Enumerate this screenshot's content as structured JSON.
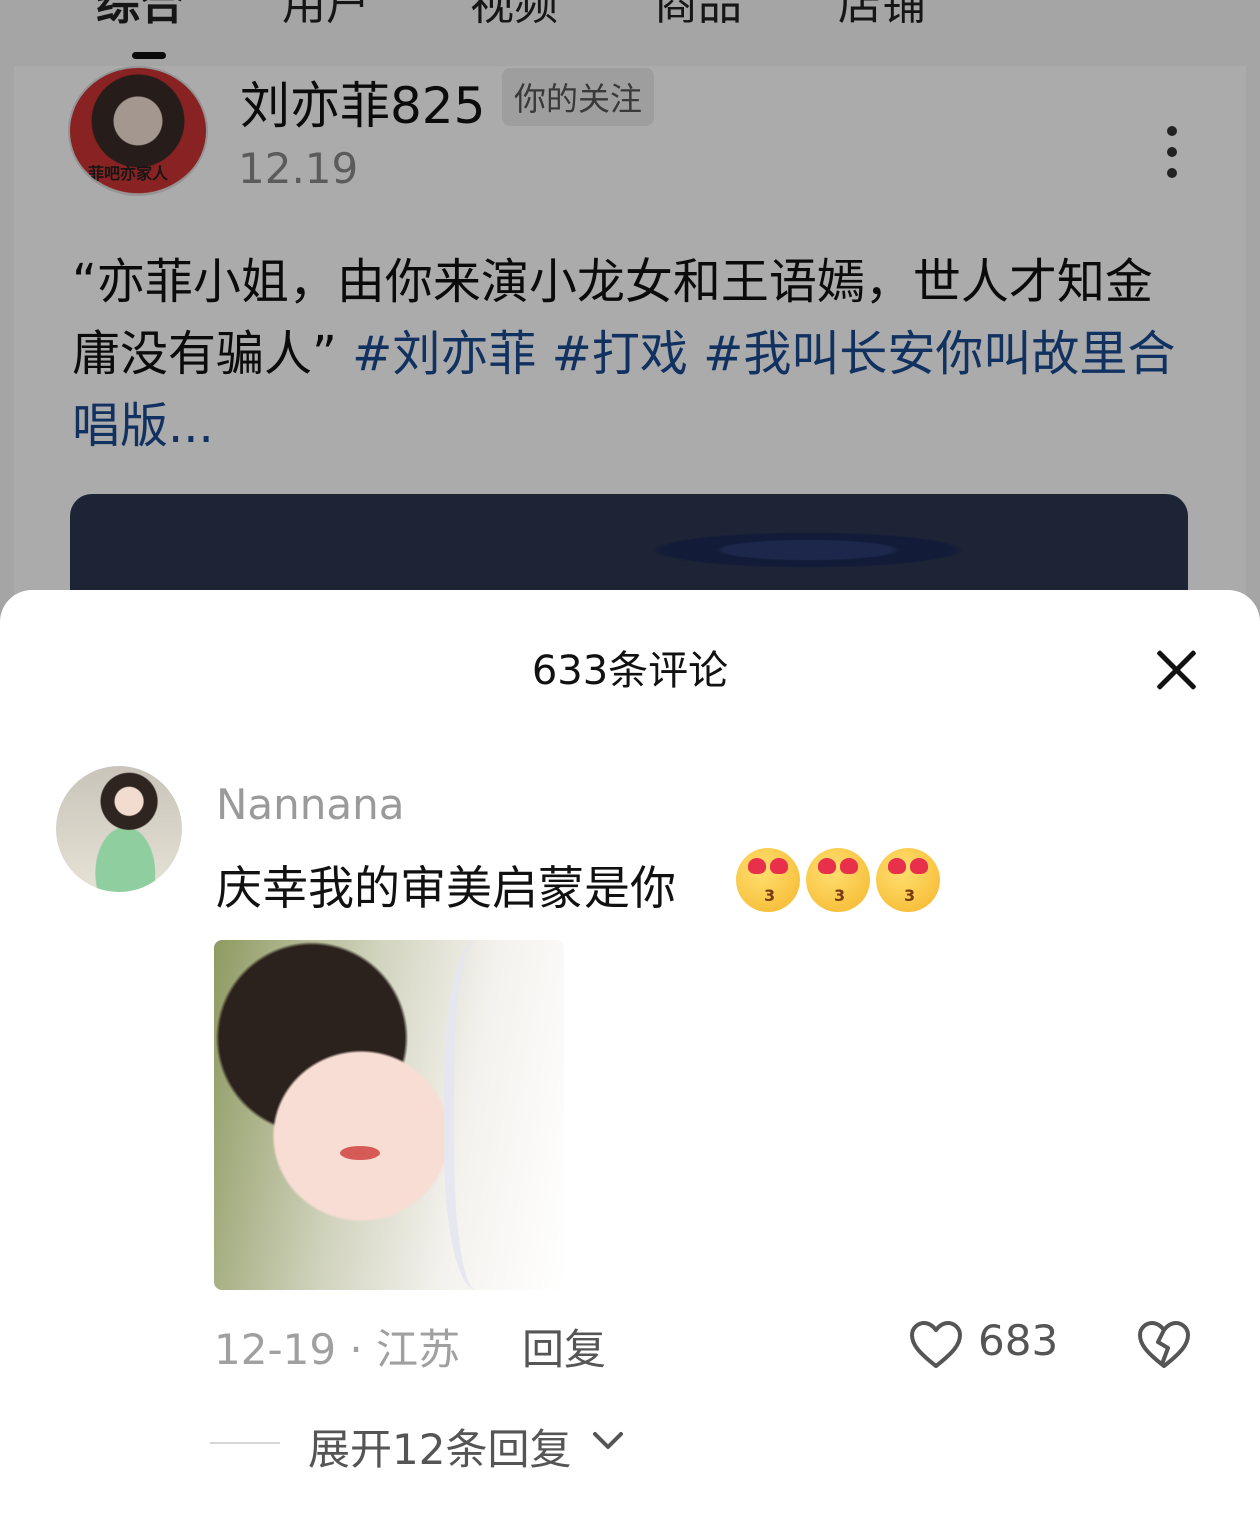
{
  "top_tabs": [
    "综合",
    "用户",
    "视频",
    "商品",
    "店铺"
  ],
  "post": {
    "author_name": "刘亦菲825",
    "avatar_caption": "菲吧亦家人",
    "follow_badge": "你的关注",
    "date": "12.19",
    "text_plain": "“亦菲小姐，由你来演小龙女和王语嫣，世人才知金庸没有骗人”",
    "tags": "#刘亦菲 #打戏 #我叫长安你叫故里合唱版..."
  },
  "sheet": {
    "title": "633条评论"
  },
  "comment": {
    "user": "Nannana",
    "text": "庆幸我的审美启蒙是你",
    "emojis": [
      "heart-eyes-kiss-emoji",
      "heart-eyes-kiss-emoji",
      "heart-eyes-kiss-emoji"
    ],
    "date_location": "12-19 · 江苏",
    "reply_label": "回复",
    "like_count": "683",
    "expand_label": "展开12条回复"
  },
  "colors": {
    "tag_link": "#1a4a90",
    "muted_text": "#9a9a9a",
    "overlay": "rgba(0,0,0,0.33)"
  }
}
